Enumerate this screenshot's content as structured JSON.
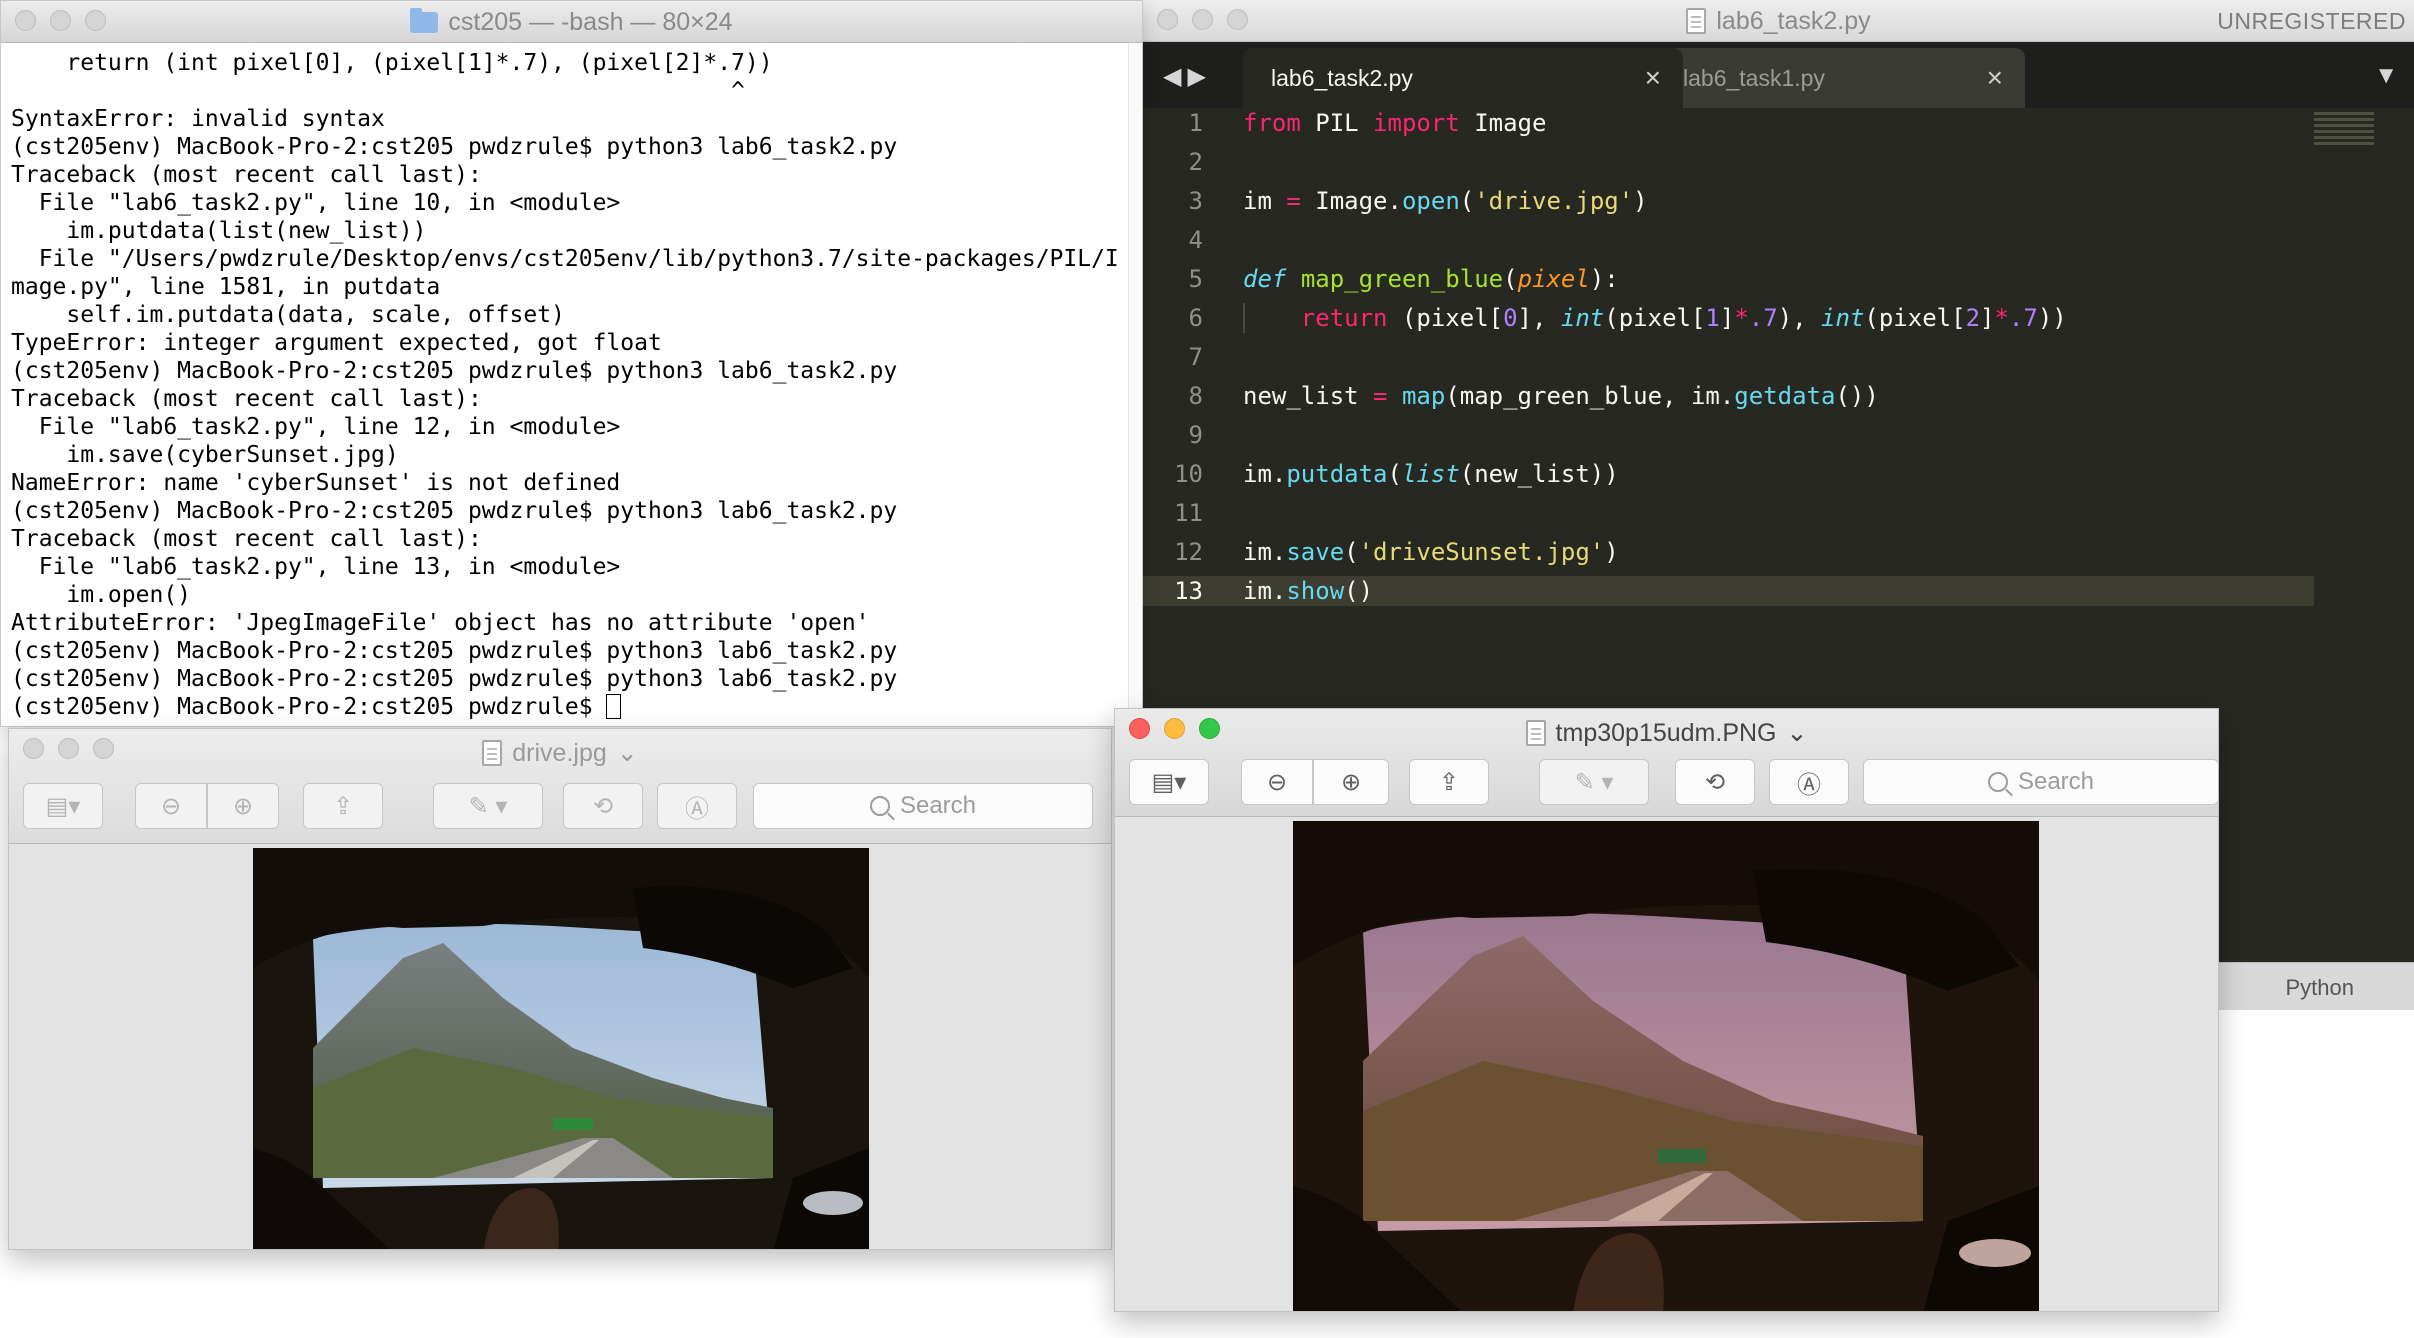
{
  "terminal": {
    "title": "cst205 — -bash — 80×24",
    "lines": [
      "    return (int pixel[0], (pixel[1]*.7), (pixel[2]*.7))",
      "                                                    ^",
      "SyntaxError: invalid syntax",
      "(cst205env) MacBook-Pro-2:cst205 pwdzrule$ python3 lab6_task2.py",
      "Traceback (most recent call last):",
      "  File \"lab6_task2.py\", line 10, in <module>",
      "    im.putdata(list(new_list))",
      "  File \"/Users/pwdzrule/Desktop/envs/cst205env/lib/python3.7/site-packages/PIL/I",
      "mage.py\", line 1581, in putdata",
      "    self.im.putdata(data, scale, offset)",
      "TypeError: integer argument expected, got float",
      "(cst205env) MacBook-Pro-2:cst205 pwdzrule$ python3 lab6_task2.py",
      "Traceback (most recent call last):",
      "  File \"lab6_task2.py\", line 12, in <module>",
      "    im.save(cyberSunset.jpg)",
      "NameError: name 'cyberSunset' is not defined",
      "(cst205env) MacBook-Pro-2:cst205 pwdzrule$ python3 lab6_task2.py",
      "Traceback (most recent call last):",
      "  File \"lab6_task2.py\", line 13, in <module>",
      "    im.open()",
      "AttributeError: 'JpegImageFile' object has no attribute 'open'",
      "(cst205env) MacBook-Pro-2:cst205 pwdzrule$ python3 lab6_task2.py",
      "(cst205env) MacBook-Pro-2:cst205 pwdzrule$ python3 lab6_task2.py",
      "(cst205env) MacBook-Pro-2:cst205 pwdzrule$ "
    ]
  },
  "sublime": {
    "title": "lab6_task2.py",
    "unregistered": "UNREGISTERED",
    "tabs": [
      {
        "label": "lab6_task2.py",
        "active": true
      },
      {
        "label": "lab6_task1.py",
        "active": false
      }
    ],
    "line_numbers": [
      "1",
      "2",
      "3",
      "4",
      "5",
      "6",
      "7",
      "8",
      "9",
      "10",
      "11",
      "12",
      "13"
    ],
    "current_line": 13,
    "syntax": "Python",
    "code": [
      [
        {
          "t": "from",
          "c": "kw"
        },
        {
          "t": " PIL ",
          "c": ""
        },
        {
          "t": "import",
          "c": "kw"
        },
        {
          "t": " Image",
          "c": ""
        }
      ],
      [],
      [
        {
          "t": "im ",
          "c": ""
        },
        {
          "t": "=",
          "c": "kw"
        },
        {
          "t": " Image.",
          "c": ""
        },
        {
          "t": "open",
          "c": "fn"
        },
        {
          "t": "(",
          "c": ""
        },
        {
          "t": "'drive.jpg'",
          "c": "st"
        },
        {
          "t": ")",
          "c": ""
        }
      ],
      [],
      [
        {
          "t": "def",
          "c": "it"
        },
        {
          "t": " ",
          "c": ""
        },
        {
          "t": "map_green_blue",
          "c": "fnd"
        },
        {
          "t": "(",
          "c": ""
        },
        {
          "t": "pixel",
          "c": "pa"
        },
        {
          "t": "):",
          "c": ""
        }
      ],
      [
        {
          "t": "    ",
          "c": ""
        },
        {
          "t": "return",
          "c": "kw"
        },
        {
          "t": " (pixel[",
          "c": ""
        },
        {
          "t": "0",
          "c": "nm"
        },
        {
          "t": "], ",
          "c": ""
        },
        {
          "t": "int",
          "c": "it"
        },
        {
          "t": "(pixel[",
          "c": ""
        },
        {
          "t": "1",
          "c": "nm"
        },
        {
          "t": "]",
          "c": ""
        },
        {
          "t": "*",
          "c": "kw"
        },
        {
          "t": ".7",
          "c": "nm"
        },
        {
          "t": "), ",
          "c": ""
        },
        {
          "t": "int",
          "c": "it"
        },
        {
          "t": "(pixel[",
          "c": ""
        },
        {
          "t": "2",
          "c": "nm"
        },
        {
          "t": "]",
          "c": ""
        },
        {
          "t": "*",
          "c": "kw"
        },
        {
          "t": ".7",
          "c": "nm"
        },
        {
          "t": "))",
          "c": ""
        }
      ],
      [],
      [
        {
          "t": "new_list ",
          "c": ""
        },
        {
          "t": "=",
          "c": "kw"
        },
        {
          "t": " ",
          "c": ""
        },
        {
          "t": "map",
          "c": "fn"
        },
        {
          "t": "(map_green_blue, im.",
          "c": ""
        },
        {
          "t": "getdata",
          "c": "fn"
        },
        {
          "t": "())",
          "c": ""
        }
      ],
      [],
      [
        {
          "t": "im.",
          "c": ""
        },
        {
          "t": "putdata",
          "c": "fn"
        },
        {
          "t": "(",
          "c": ""
        },
        {
          "t": "list",
          "c": "it"
        },
        {
          "t": "(new_list))",
          "c": ""
        }
      ],
      [],
      [
        {
          "t": "im.",
          "c": ""
        },
        {
          "t": "save",
          "c": "fn"
        },
        {
          "t": "(",
          "c": ""
        },
        {
          "t": "'driveSunset.jpg'",
          "c": "st"
        },
        {
          "t": ")",
          "c": ""
        }
      ],
      [
        {
          "t": "im.",
          "c": ""
        },
        {
          "t": "show",
          "c": "fn"
        },
        {
          "t": "()",
          "c": ""
        }
      ]
    ]
  },
  "preview_original": {
    "title": "drive.jpg",
    "search_placeholder": "Search"
  },
  "preview_result": {
    "title": "tmp30p15udm.PNG",
    "search_placeholder": "Search"
  },
  "icons": {
    "sidebar_toggle": "sidebar-icon",
    "zoom_out": "zoom-out-icon",
    "zoom_in": "zoom-in-icon",
    "share": "share-icon",
    "markup": "pen-icon",
    "rotate": "rotate-icon",
    "annotate": "markup-circle-icon",
    "search": "search-icon"
  },
  "colors": {
    "editor_bg": "#272822",
    "keyword": "#f92672",
    "function": "#66d9ef",
    "string": "#e6db74",
    "number": "#ae81ff",
    "param": "#fd971f",
    "close_light": "#fc605c",
    "minimize_light": "#fdbc40",
    "zoom_light": "#34c84a"
  }
}
